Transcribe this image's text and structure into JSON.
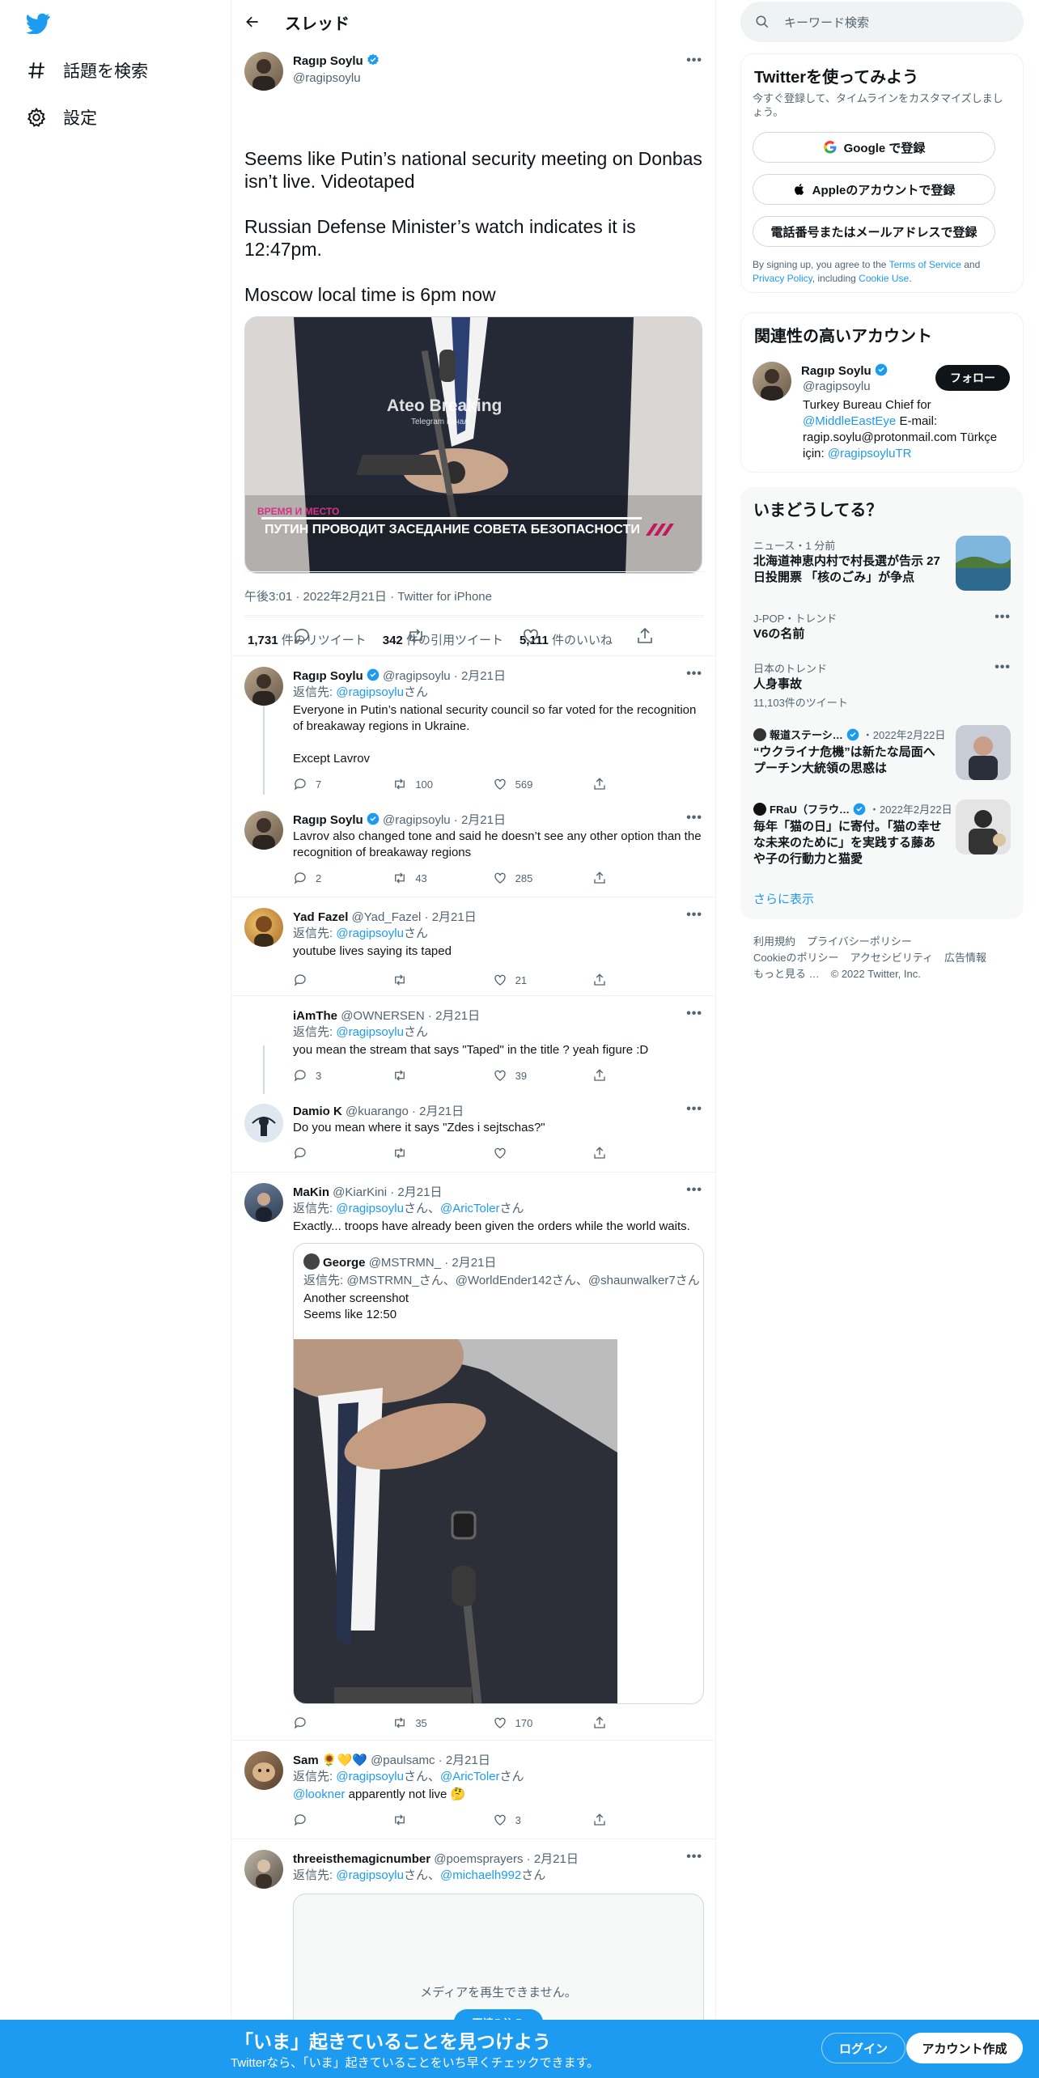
{
  "nav": {
    "explore_label": "話題を検索",
    "settings_label": "設定"
  },
  "header": {
    "title": "スレッド"
  },
  "main_tweet": {
    "name": "Ragıp Soylu",
    "handle": "@ragipsoylu",
    "text": "Seems like Putin’s national security meeting on Donbas isn’t live. Videotaped\n\nRussian Defense Minister’s watch indicates it is 12:47pm.\n\nMoscow local time is 6pm now",
    "media_watermark": "Ateo Breaking",
    "media_watermark_sub": "Telegram канал",
    "media_caption": "ПУТИН ПРОВОДИТ ЗАСЕДАНИЕ СОВЕТА БЕЗОПАСНОСТИ",
    "meta": "午後3:01 · 2022年2月21日 · Twitter for iPhone",
    "retweets_count": "1,731",
    "retweets_label": "件のリツイート",
    "quotes_count": "342",
    "quotes_label": "件の引用ツイート",
    "likes_count": "5,111",
    "likes_label": "件のいいね"
  },
  "replies": [
    {
      "name": "Ragıp Soylu",
      "handle_date": "@ragipsoylu · 2月21日",
      "reply_to_prefix": "返信先: ",
      "reply_to": "@ragipsoylu",
      "reply_to_suffix": "さん",
      "text": "Everyone in Putin’s national security council so far voted for the recognition of breakaway regions in Ukraine.\n\nExcept Lavrov",
      "replies": "7",
      "retweets": "100",
      "likes": "569"
    },
    {
      "name": "Ragıp Soylu",
      "handle_date": "@ragipsoylu · 2月21日",
      "text": "Lavrov also changed tone and said he doesn’t see any other option than the recognition of breakaway regions",
      "replies": "2",
      "retweets": "43",
      "likes": "285"
    },
    {
      "name": "Yad Fazel",
      "handle_date": "@Yad_Fazel · 2月21日",
      "reply_to_prefix": "返信先: ",
      "reply_to": "@ragipsoylu",
      "reply_to_suffix": "さん",
      "text": "youtube lives saying its taped",
      "replies": "",
      "retweets": "",
      "likes": "21"
    },
    {
      "name": "iAmThe",
      "handle_date": "@OWNERSEN · 2月21日",
      "reply_to_prefix": "返信先: ",
      "reply_to": "@ragipsoylu",
      "reply_to_suffix": "さん",
      "text": "you mean the stream that says \"Taped\" in the title ? yeah figure :D",
      "replies": "3",
      "retweets": "",
      "likes": "39"
    },
    {
      "name": "Damio K",
      "handle_date": "@kuarango · 2月21日",
      "text": "Do you mean where it says \"Zdes i sejtschas?\"",
      "replies": "",
      "retweets": "",
      "likes": ""
    },
    {
      "name": "MaKin",
      "handle_date": "@KiarKini · 2月21日",
      "reply_to_prefix": "返信先: ",
      "reply_to": "@ragipsoylu",
      "reply_to_mid": "さん、",
      "reply_to_2": "@AricToler",
      "reply_to_suffix": "さん",
      "text": "Exactly... troops have already been given the orders while the world waits.",
      "quote": {
        "name": "George",
        "handle_date": "@MSTRMN_ · 2月21日",
        "reply_line": "返信先: @MSTRMN_さん、@WorldEnder142さん、@shaunwalker7さん",
        "text": "Another screenshot\nSeems like 12:50"
      },
      "replies": "",
      "retweets": "35",
      "likes": "170"
    },
    {
      "name": "Sam 🌻💛💙",
      "handle_date": "@paulsamc · 2月21日",
      "reply_to_prefix": "返信先: ",
      "reply_to": "@ragipsoylu",
      "reply_to_mid": "さん、",
      "reply_to_2": "@AricToler",
      "reply_to_suffix": "さん",
      "mention": "@lookner",
      "text": " apparently not live 🤔",
      "replies": "",
      "retweets": "",
      "likes": "3"
    },
    {
      "name": "threeisthemagicnumber",
      "handle_date": "@poemsprayers · 2月21日",
      "reply_to_prefix": "返信先: ",
      "reply_to": "@ragipsoylu",
      "reply_to_mid": "さん、",
      "reply_to_2": "@michaelh992",
      "reply_to_suffix": "さん",
      "media_error": "メディアを再生できません。",
      "media_button": "再読み込み"
    }
  ],
  "right": {
    "search_placeholder": "キーワード検索",
    "signup": {
      "title": "Twitterを使ってみよう",
      "subtitle": "今すぐ登録して、タイムラインをカスタマイズしましょう。",
      "google": "Google で登録",
      "apple": "Appleのアカウントで登録",
      "phone": "電話番号またはメールアドレスで登録",
      "terms_prefix": "By signing up, you agree to the ",
      "terms_link": "Terms of Service",
      "terms_and": " and ",
      "privacy_link": "Privacy Policy",
      "terms_including": ", including ",
      "cookie_link": "Cookie Use",
      "terms_end": "."
    },
    "related": {
      "title": "関連性の高いアカウント",
      "name": "Ragıp Soylu",
      "handle": "@ragipsoylu",
      "follow": "フォロー",
      "bio_1": "Turkey Bureau Chief for",
      "bio_link_1": "@MiddleEastEye",
      "bio_2": " E-mail:",
      "bio_3": "ragip.soylu@protonmail.com Türkçe",
      "bio_4": "için: ",
      "bio_link_2": "@ragipsoyluTR"
    },
    "trends": {
      "title": "いまどうしてる？",
      "items": [
        {
          "label": "ニュース・1 分前",
          "title": "北海道神恵内村で村長選が告示 27日投開票 「核のごみ」が争点"
        },
        {
          "label": "J-POP・トレンド",
          "title": "V6の名前"
        },
        {
          "label": "日本のトレンド",
          "title": "人身事故",
          "sub": "11,103件のツイート"
        },
        {
          "source": "報道ステーシ…",
          "date": "・2022年2月22日",
          "title": "“ウクライナ危機”は新たな局面へ プーチン大統領の思惑は"
        },
        {
          "source": "FRaU（フラウ…",
          "date": "・2022年2月22日",
          "title": "毎年「猫の日」に寄付。「猫の幸せな未来のために」を実践する藤あや子の行動力と猫愛"
        }
      ],
      "show_more": "さらに表示"
    },
    "footer": {
      "line1": [
        "利用規約",
        "プライバシーポリシー"
      ],
      "line2": [
        "Cookieのポリシー",
        "アクセシビリティ",
        "広告情報"
      ],
      "line3": [
        "もっと見る …",
        "© 2022 Twitter, Inc."
      ]
    }
  },
  "bottombar": {
    "title": "「いま」起きていることを見つけよう",
    "subtitle": "Twitterなら、「いま」起きていることをいち早くチェックできます。",
    "login": "ログイン",
    "signup": "アカウント作成"
  }
}
